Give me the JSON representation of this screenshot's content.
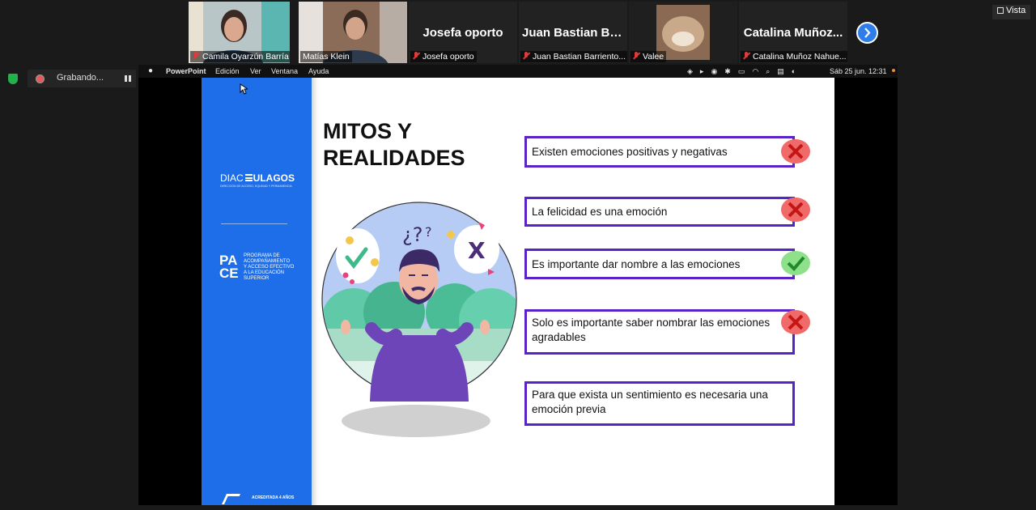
{
  "view_button": {
    "icon": "grid-icon",
    "label": "Vista"
  },
  "participants": [
    {
      "display": "",
      "label": "Camila Oyarzún Barría",
      "muted": true,
      "video": true
    },
    {
      "display": "",
      "label": "Matías Klein",
      "muted": false,
      "video": true
    },
    {
      "display": "Josefa oporto",
      "label": "Josefa oporto",
      "muted": true,
      "video": false
    },
    {
      "display": "Juan Bastian Ba...",
      "label": "Juan Bastian Barriento...",
      "muted": true,
      "video": false
    },
    {
      "display": "",
      "label": "Valee",
      "muted": true,
      "video": true
    },
    {
      "display": "Catalina Muñoz...",
      "label": "Catalina Muñoz Nahue...",
      "muted": true,
      "video": false
    }
  ],
  "recording": {
    "label": "Grabando..."
  },
  "mac_menu": {
    "app": "PowerPoint",
    "items": [
      "Edición",
      "Ver",
      "Ventana",
      "Ayuda"
    ],
    "clock": "Sáb 25 jun.  12:31"
  },
  "slide": {
    "title_line1": "MITOS Y",
    "title_line2": "REALIDADES",
    "logo_diac": "DIAC",
    "logo_ulagos": "ULAGOS",
    "logo_sub": "DIRECCIÓN DE ACCESO, EQUIDAD Y PERMANENCIA",
    "pace_letters": [
      "PA",
      "CE"
    ],
    "pace_text": [
      "PROGRAMA DE",
      "ACOMPAÑAMIENTO",
      "Y ACCESO EFECTIVO",
      "A LA EDUCACIÓN",
      "SUPERIOR"
    ],
    "accredited": "ACREDITADA 4 AÑOS",
    "statements": [
      {
        "text": "Existen emociones positivas y negativas",
        "verdict": "false"
      },
      {
        "text": "La felicidad es una emoción",
        "verdict": "false"
      },
      {
        "text": "Es importante dar nombre a las emociones",
        "verdict": "true"
      },
      {
        "text": "Solo es importante saber nombrar las emociones agradables",
        "verdict": "false"
      },
      {
        "text": "Para que exista un sentimiento es necesaria una emoción previa",
        "verdict": "none"
      }
    ]
  },
  "colors": {
    "accent_blue": "#1d6ee8",
    "box_border": "#5a23c8",
    "false_badge": "#f06a6a",
    "true_badge": "#8fe08a"
  }
}
